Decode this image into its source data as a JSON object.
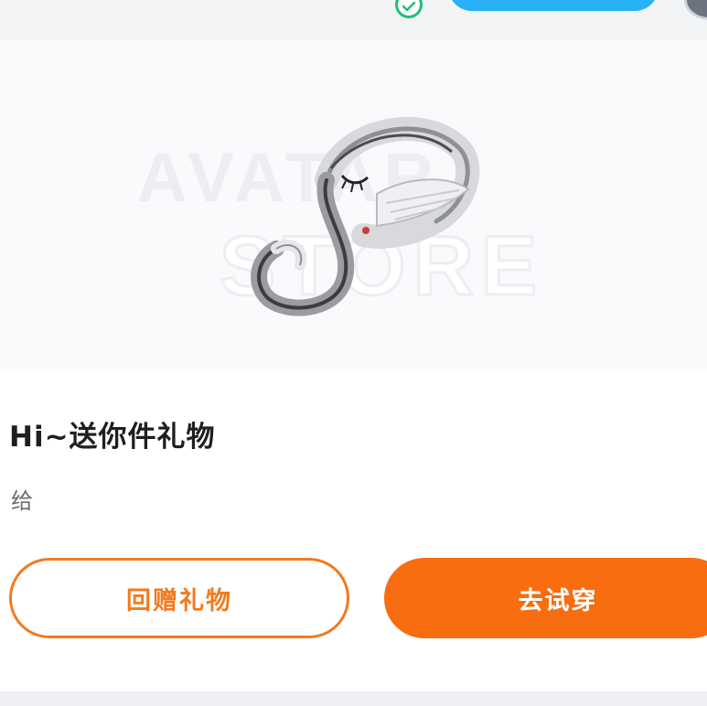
{
  "header": {
    "verified_icon": "check-circle-icon",
    "follow_button_color": "#2ab0f6",
    "avatar": "user-avatar"
  },
  "preview": {
    "watermark_line1": "AVATAR",
    "watermark_line2": "STORE",
    "item_art": "hairpiece-artwork"
  },
  "gift": {
    "title": "Hi~送你件礼物",
    "from_label": "给"
  },
  "actions": {
    "return_gift_label": "回赠礼物",
    "try_on_label": "去试穿",
    "accent_color": "#f76d10"
  }
}
